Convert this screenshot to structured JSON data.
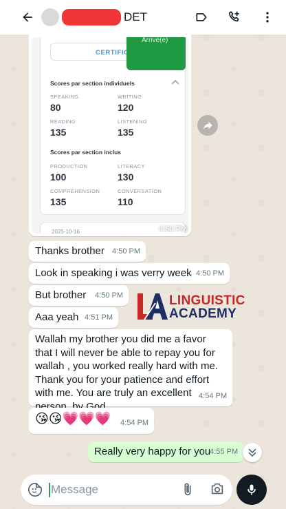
{
  "header": {
    "contact_suffix": "DET",
    "icons": [
      "back-arrow-icon",
      "label-icon",
      "add-call-icon",
      "more-vert-icon"
    ]
  },
  "image_message": {
    "certificate_label": "CERTIFICA",
    "status_fragment": "Arrivé(e)",
    "individual_title": "Scores par section individuels",
    "individual_scores": [
      {
        "label": "SPEAKING",
        "value": "80"
      },
      {
        "label": "WRITING",
        "value": "120"
      },
      {
        "label": "READING",
        "value": "135"
      },
      {
        "label": "LISTENING",
        "value": "135"
      }
    ],
    "combined_title": "Scores par section inclus",
    "combined_scores": [
      {
        "label": "PRODUCTION",
        "value": "100"
      },
      {
        "label": "LITERACY",
        "value": "130"
      },
      {
        "label": "COMPREHENSION",
        "value": "135"
      },
      {
        "label": "CONVERSATION",
        "value": "110"
      }
    ],
    "date": "2025-10-16",
    "time": "4:50 PM"
  },
  "messages": [
    {
      "text": "Thanks brother",
      "time": "4:50 PM",
      "direction": "in"
    },
    {
      "text": "Look in speaking i was verry week",
      "time": "4:50 PM",
      "direction": "in"
    },
    {
      "text": "But brother",
      "time": "4:50 PM",
      "direction": "in"
    },
    {
      "text": "Aaa yeah",
      "time": "4:51 PM",
      "direction": "in"
    },
    {
      "text": "Wallah my brother you did me a favor that I will never be able to repay you for wallah , you worked really hard with me. Thank you for your patience and effort with me. You are truly an excellent person, by God",
      "time": "4:54 PM",
      "direction": "in"
    },
    {
      "text": "😘😘💗💗💗",
      "time": "4:54 PM",
      "direction": "in"
    },
    {
      "text": "Really very happy for you",
      "time": "4:55 PM",
      "direction": "out"
    }
  ],
  "watermark": {
    "line1": "LINGUISTIC",
    "line2": "ACADEMY",
    "mark": "LA"
  },
  "input": {
    "placeholder": "Message"
  },
  "colors": {
    "outgoing_bubble": "#d9fdd3",
    "header_bg": "#ffffff",
    "logo_red": "#c62828",
    "logo_navy": "#1e2d63",
    "card_green": "#1f9a43"
  }
}
